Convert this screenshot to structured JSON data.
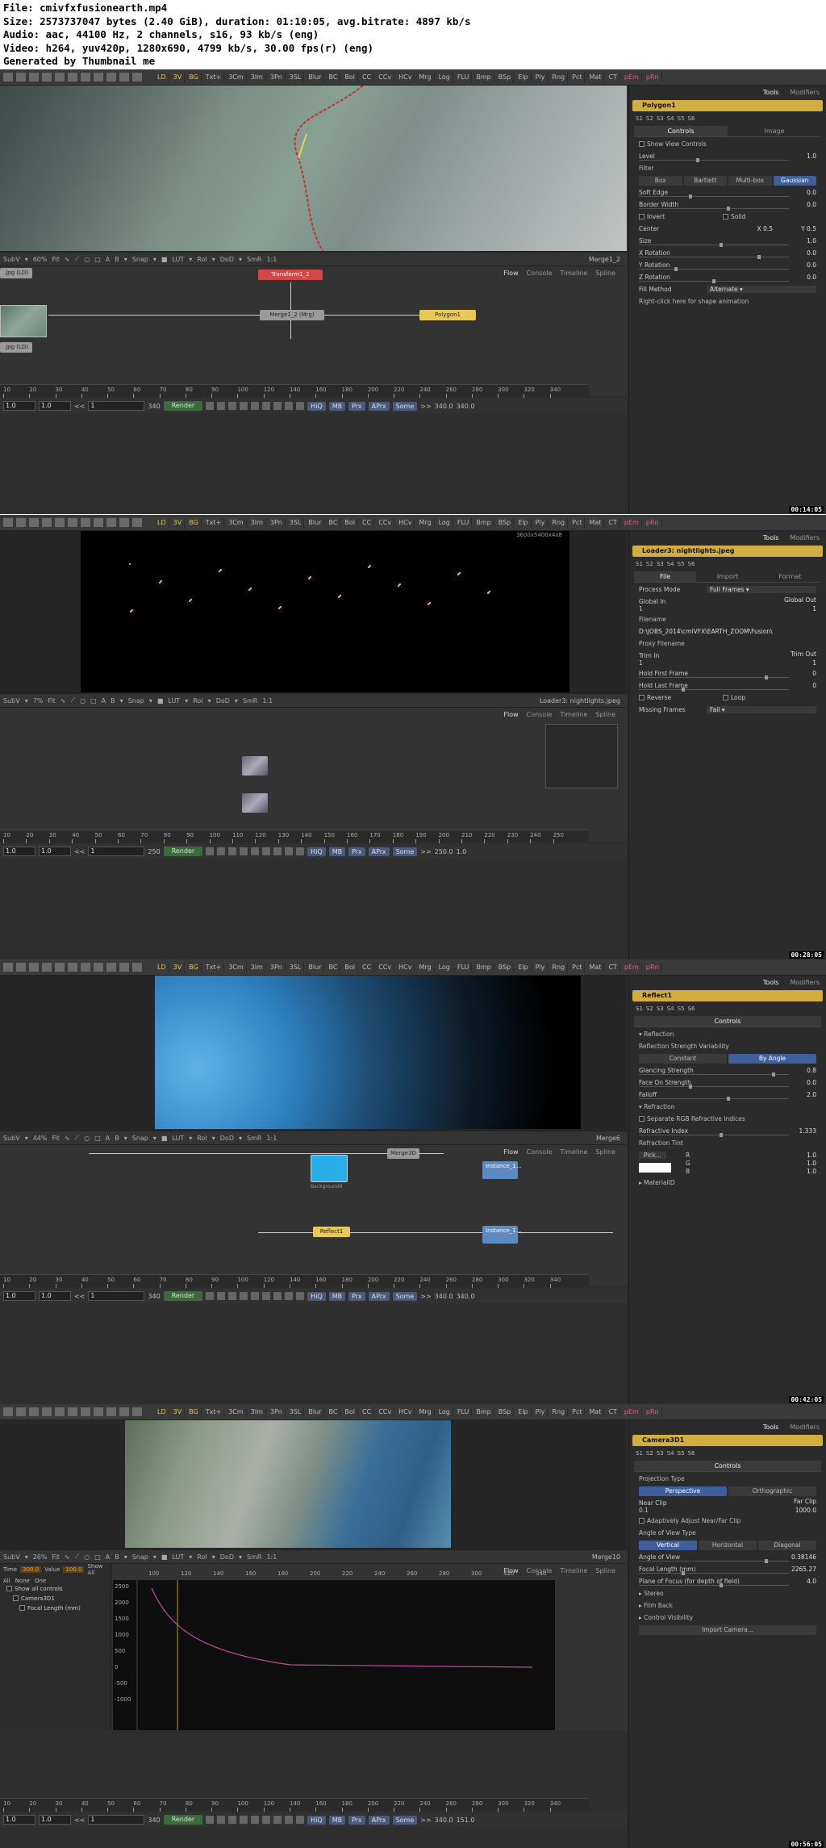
{
  "info": {
    "file": "File: cmivfxfusionearth.mp4",
    "size": "Size: 2573737047 bytes (2.40 GiB), duration: 01:10:05, avg.bitrate: 4897 kb/s",
    "audio": "Audio: aac, 44100 Hz, 2 channels, s16, 93 kb/s (eng)",
    "video": "Video: h264, yuv420p, 1280x690, 4799 kb/s, 30.00 fps(r) (eng)",
    "generated": "Generated by Thumbnail me"
  },
  "toolbar_tools": [
    "LD",
    "3V",
    "BG",
    "Txt+",
    "3Cm",
    "3Im",
    "3Pn",
    "3SL",
    "Blur",
    "BC",
    "Bol",
    "CC",
    "CCv",
    "HCv",
    "Mrg",
    "Log",
    "FLU",
    "Bmp",
    "BSp",
    "Elp",
    "Ply",
    "Rng",
    "Pct",
    "Mat",
    "CT",
    "pEm",
    "pRn"
  ],
  "colors": {
    "accent": "#d2ad40",
    "selected": "#3e5f9c",
    "panel": "#2e2e2e"
  },
  "panels": [
    {
      "timestamp": "00:14:05",
      "viewer_label": "Merge1_2",
      "zoom": "60%",
      "flow_tabs": [
        "Flow",
        "Console",
        "Timeline",
        "Spline"
      ],
      "nodes": [
        "Transform1_2",
        "Merge1_2 (Mrg)",
        "Polygon1",
        ".jpg (LD)",
        ".jpg (LD)"
      ],
      "ruler": [
        "10",
        "20",
        "30",
        "40",
        "50",
        "60",
        "70",
        "80",
        "90",
        "100",
        "120",
        "140",
        "160",
        "180",
        "200",
        "220",
        "240",
        "260",
        "280",
        "300",
        "320",
        "340"
      ],
      "transport": {
        "start": "1.0",
        "end": "1.0",
        "cur": "1",
        "len": "340",
        "render": "Render",
        "rend_end": "340.0",
        "rend_end2": "340.0",
        "hq": "HiQ",
        "mb": "MB",
        "prx": "Prx",
        "aprx": "APrx",
        "some": "Some"
      },
      "insp_tabs": [
        "Tools",
        "Modifiers"
      ],
      "insp_title": "Polygon1",
      "subtabs": [
        "Controls",
        "Image"
      ],
      "rows": [
        {
          "t": "check",
          "l": "Show View Controls"
        },
        {
          "t": "slider",
          "l": "Level",
          "v": "1.0"
        },
        {
          "t": "label",
          "l": "Filter"
        },
        {
          "t": "buttons",
          "b": [
            "Box",
            "Bartlett",
            "Multi-box",
            "Gaussian"
          ],
          "sel": 3
        },
        {
          "t": "slider",
          "l": "Soft Edge",
          "v": "0.0"
        },
        {
          "t": "slider",
          "l": "Border Width",
          "v": "0.0"
        },
        {
          "t": "check2",
          "l": "Invert",
          "l2": "Solid"
        },
        {
          "t": "xy",
          "l": "Center",
          "x": "0.5",
          "y": "0.5"
        },
        {
          "t": "slider",
          "l": "Size",
          "v": "1.0"
        },
        {
          "t": "slider",
          "l": "X Rotation",
          "v": "0.0"
        },
        {
          "t": "slider",
          "l": "Y Rotation",
          "v": "0.0"
        },
        {
          "t": "slider",
          "l": "Z Rotation",
          "v": "0.0"
        },
        {
          "t": "combo",
          "l": "Fill Method",
          "v": "Alternate"
        },
        {
          "t": "label",
          "l": "Right-click here for shape animation"
        }
      ]
    },
    {
      "timestamp": "00:28:05",
      "viewer_label": "Loader3: nightlights.jpeg",
      "zoom": "7%",
      "res": "3600x5400x4x8",
      "flow_tabs": [
        "Flow",
        "Console",
        "Timeline",
        "Spline"
      ],
      "ruler": [
        "10",
        "20",
        "30",
        "40",
        "50",
        "60",
        "70",
        "80",
        "90",
        "100",
        "110",
        "120",
        "130",
        "140",
        "150",
        "160",
        "170",
        "180",
        "190",
        "200",
        "210",
        "220",
        "230",
        "240",
        "250"
      ],
      "transport": {
        "start": "1.0",
        "end": "1.0",
        "cur": "1",
        "len": "250",
        "render": "Render",
        "rend_end": "250.0",
        "rend_end2": "1.0",
        "hq": "HiQ",
        "mb": "MB",
        "prx": "Prx",
        "aprx": "APrx",
        "some": "Some"
      },
      "insp_tabs": [
        "Tools",
        "Modifiers"
      ],
      "insp_title": "Loader3: nightlights.jpeg",
      "subtabs": [
        "File",
        "Import",
        "Format"
      ],
      "rows": [
        {
          "t": "combo",
          "l": "Process Mode",
          "v": "Full Frames"
        },
        {
          "t": "range",
          "l": "Global In",
          "l2": "Global Out",
          "a": "1",
          "b": "1",
          "c": "1",
          "d": "1"
        },
        {
          "t": "label",
          "l": "Filename"
        },
        {
          "t": "path",
          "v": "D:\\JOBS_2014\\cmiVFX\\EARTH_ZOOM\\Fusion\\"
        },
        {
          "t": "label",
          "l": "Proxy Filename"
        },
        {
          "t": "range",
          "l": "Trim In",
          "l2": "Trim Out",
          "a": "1",
          "b": "1",
          "c": "1",
          "d": "1"
        },
        {
          "t": "slider",
          "l": "Hold First Frame",
          "v": "0"
        },
        {
          "t": "slider",
          "l": "Hold Last Frame",
          "v": "0"
        },
        {
          "t": "check2",
          "l": "Reverse",
          "l2": "Loop"
        },
        {
          "t": "combo",
          "l": "Missing Frames",
          "v": "Fail"
        }
      ]
    },
    {
      "timestamp": "00:42:05",
      "viewer_label": "Merge6",
      "zoom": "44%",
      "flow_tabs": [
        "Flow",
        "Console",
        "Timeline",
        "Spline"
      ],
      "nodes": [
        "Merge3D",
        "Background4",
        "Instance_1...",
        "Reflect1",
        "Instance_1..."
      ],
      "ruler": [
        "10",
        "20",
        "30",
        "40",
        "50",
        "60",
        "70",
        "80",
        "90",
        "100",
        "120",
        "140",
        "160",
        "180",
        "200",
        "220",
        "240",
        "260",
        "280",
        "300",
        "320",
        "340"
      ],
      "transport": {
        "start": "1.0",
        "end": "1.0",
        "cur": "1",
        "len": "340",
        "render": "Render",
        "rend_end": "340.0",
        "rend_end2": "340.0",
        "hq": "HiQ",
        "mb": "MB",
        "prx": "Prx",
        "aprx": "APrx",
        "some": "Some"
      },
      "insp_tabs": [
        "Tools",
        "Modifiers"
      ],
      "insp_title": "Reflect1",
      "subtabs": [
        "Controls"
      ],
      "rows": [
        {
          "t": "label",
          "l": "▾ Reflection"
        },
        {
          "t": "label",
          "l": "Reflection Strength Variability"
        },
        {
          "t": "buttons",
          "b": [
            "Constant",
            "By Angle"
          ],
          "sel": 1
        },
        {
          "t": "slider",
          "l": "Glancing Strength",
          "v": "0.8"
        },
        {
          "t": "slider",
          "l": "Face On Strength",
          "v": "0.0"
        },
        {
          "t": "slider",
          "l": "Falloff",
          "v": "2.0"
        },
        {
          "t": "label",
          "l": "▾ Refraction"
        },
        {
          "t": "check",
          "l": "Separate RGB Refractive Indices"
        },
        {
          "t": "slider",
          "l": "Refractive Index",
          "v": "1.333"
        },
        {
          "t": "label",
          "l": "Refraction Tint"
        },
        {
          "t": "rgb",
          "r": "1.0",
          "g": "1.0",
          "b": "1.0",
          "pick": "Pick..."
        },
        {
          "t": "label",
          "l": "▸ MaterialID"
        }
      ]
    },
    {
      "timestamp": "00:56:05",
      "viewer_label": "Merge10",
      "zoom": "26%",
      "flow_tabs": [
        "Flow",
        "Console",
        "Timeline",
        "Spline"
      ],
      "spline_left": {
        "time_label": "Time",
        "time_val": "300.0",
        "value_label": "Value",
        "value_val": "100.0",
        "show": "Show All",
        "filter": [
          "All",
          "None",
          "One"
        ],
        "tree": [
          "Show all controls",
          "Camera3D1",
          "Focal Length (mm)"
        ]
      },
      "graph_y": [
        "2500",
        "2000",
        "1500",
        "1000",
        "500",
        "0",
        "-500",
        "-1000"
      ],
      "graph_x": [
        "100",
        "120",
        "140",
        "160",
        "180",
        "200",
        "220",
        "240",
        "260",
        "280",
        "300",
        "320",
        "340"
      ],
      "ruler": [
        "10",
        "20",
        "30",
        "40",
        "50",
        "60",
        "70",
        "80",
        "90",
        "100",
        "120",
        "140",
        "160",
        "180",
        "200",
        "220",
        "240",
        "260",
        "280",
        "300",
        "320",
        "340"
      ],
      "transport": {
        "start": "1.0",
        "end": "1.0",
        "cur": "1",
        "len": "340",
        "render": "Render",
        "rend_end": "340.0",
        "rend_end2": "151.0",
        "hq": "HiQ",
        "mb": "MB",
        "prx": "Prx",
        "aprx": "APrx",
        "some": "Some"
      },
      "insp_tabs": [
        "Tools",
        "Modifiers"
      ],
      "insp_title": "Camera3D1",
      "subtabs": [
        "Controls"
      ],
      "rows": [
        {
          "t": "label",
          "l": "Projection Type"
        },
        {
          "t": "buttons",
          "b": [
            "Perspective",
            "Orthographic"
          ],
          "sel": 0
        },
        {
          "t": "range",
          "l": "Near Clip",
          "l2": "Far Clip",
          "a": "0.1",
          "b": "",
          "c": "",
          "d": "1000.0"
        },
        {
          "t": "check",
          "l": "Adaptively Adjust Near/Far Clip"
        },
        {
          "t": "label",
          "l": "Angle of View Type"
        },
        {
          "t": "buttons",
          "b": [
            "Vertical",
            "Horizontal",
            "Diagonal"
          ],
          "sel": 0
        },
        {
          "t": "slider",
          "l": "Angle of View",
          "v": "0.38146"
        },
        {
          "t": "slider",
          "l": "Focal Length (mm)",
          "v": "2265.27"
        },
        {
          "t": "slider",
          "l": "Plane of Focus (for depth of field)",
          "v": "4.0"
        },
        {
          "t": "label",
          "l": "▸ Stereo"
        },
        {
          "t": "label",
          "l": "▸ Film Back"
        },
        {
          "t": "label",
          "l": "▸ Control Visibility"
        },
        {
          "t": "buttons",
          "b": [
            "Import Camera..."
          ],
          "sel": -1
        }
      ]
    }
  ]
}
